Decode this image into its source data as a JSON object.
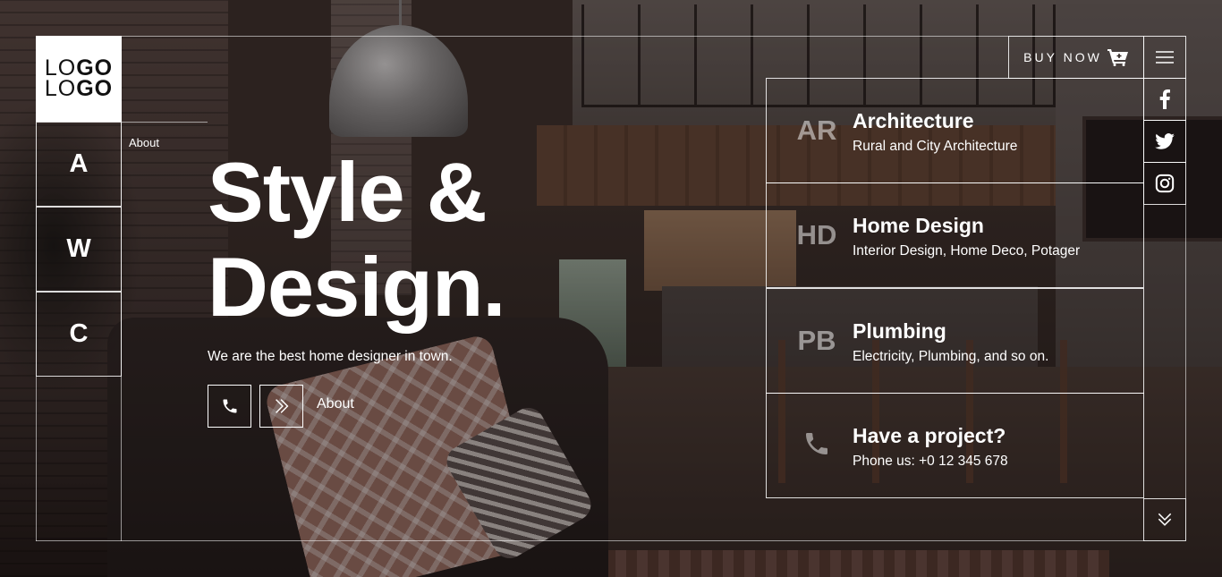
{
  "logo": {
    "line1_light": "LO",
    "line1_bold": "GO",
    "line2_light": "LO",
    "line2_bold": "GO"
  },
  "side_nav": {
    "letters": [
      "A",
      "W",
      "C"
    ],
    "about_label": "About"
  },
  "hero": {
    "title_line1": "Style &",
    "title_line2": "Design.",
    "subtitle": "We are the best home designer in town.",
    "phone_button_icon": "phone-icon",
    "next_button_icon": "double-chevron-right-icon",
    "about_link": "About"
  },
  "header": {
    "buy_now_label": "BUY NOW",
    "cart_icon": "cart-icon",
    "menu_icon": "hamburger-menu-icon"
  },
  "social": [
    "facebook-icon",
    "twitter-icon",
    "instagram-icon"
  ],
  "services": [
    {
      "abbr": "AR",
      "title": "Architecture",
      "desc": "Rural and City Architecture"
    },
    {
      "abbr": "HD",
      "title": "Home Design",
      "desc": "Interior Design, Home Deco, Potager"
    },
    {
      "abbr": "PB",
      "title": "Plumbing",
      "desc": "Electricity, Plumbing, and so on."
    },
    {
      "abbr": "",
      "title": "Have a project?",
      "desc": "Phone us: +0 12 345 678",
      "icon": "phone-icon"
    }
  ],
  "scroll_down_icon": "double-chevron-down-icon"
}
